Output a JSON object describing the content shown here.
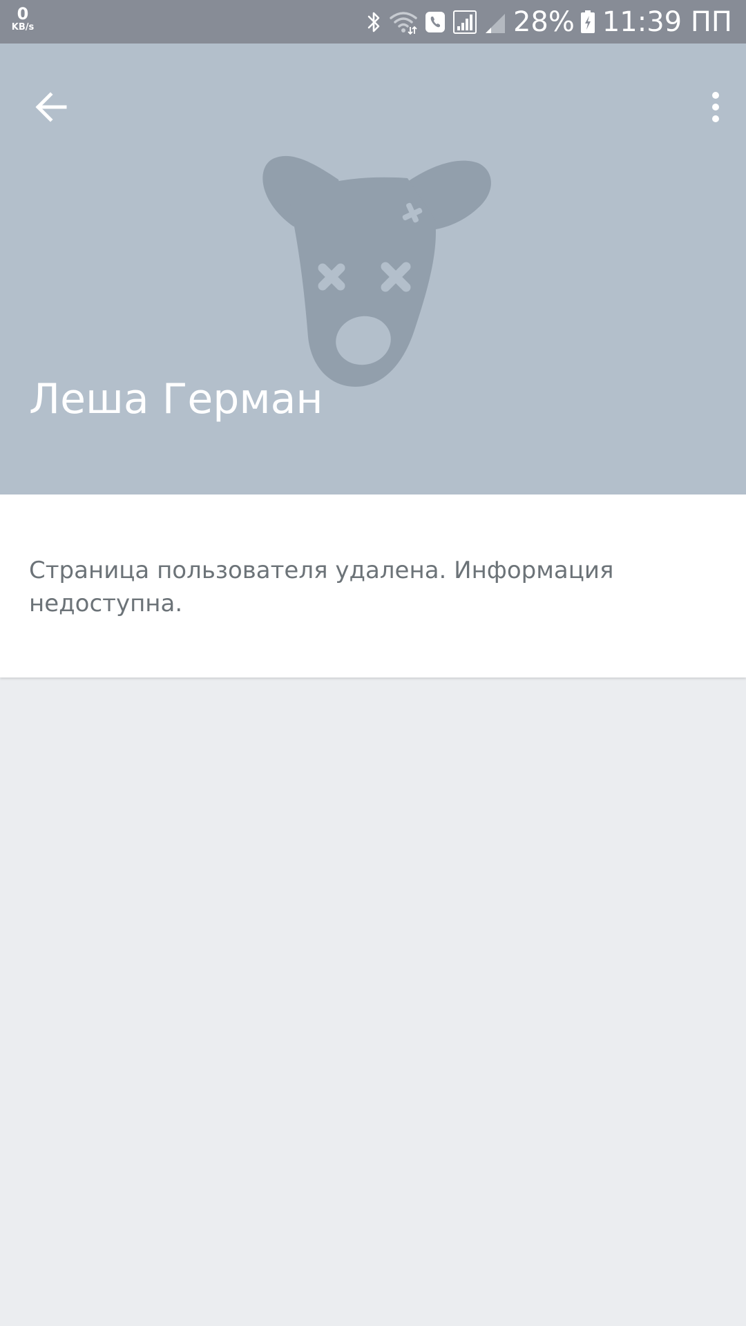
{
  "status_bar": {
    "net_speed_value": "0",
    "net_speed_unit": "KB/s",
    "battery_percent": "28%",
    "time": "11:39 ПП",
    "icons": [
      "bluetooth-icon",
      "wifi-icon",
      "call-icon",
      "signal-icon",
      "signal-weak-icon",
      "battery-charging-icon"
    ]
  },
  "header": {
    "profile_name": "Леша Герман",
    "background_color": "#b3bfcb",
    "avatar_icon": "deleted-dog-icon",
    "back_icon": "arrow-left-icon",
    "menu_icon": "more-vertical-icon"
  },
  "info_card": {
    "message": "Страница пользователя удалена. Информация недоступна."
  },
  "colors": {
    "status_bar": "#878c96",
    "header": "#b3bfcb",
    "avatar": "#929fac",
    "page_background": "#ebedf0",
    "info_text": "#6c7378"
  }
}
